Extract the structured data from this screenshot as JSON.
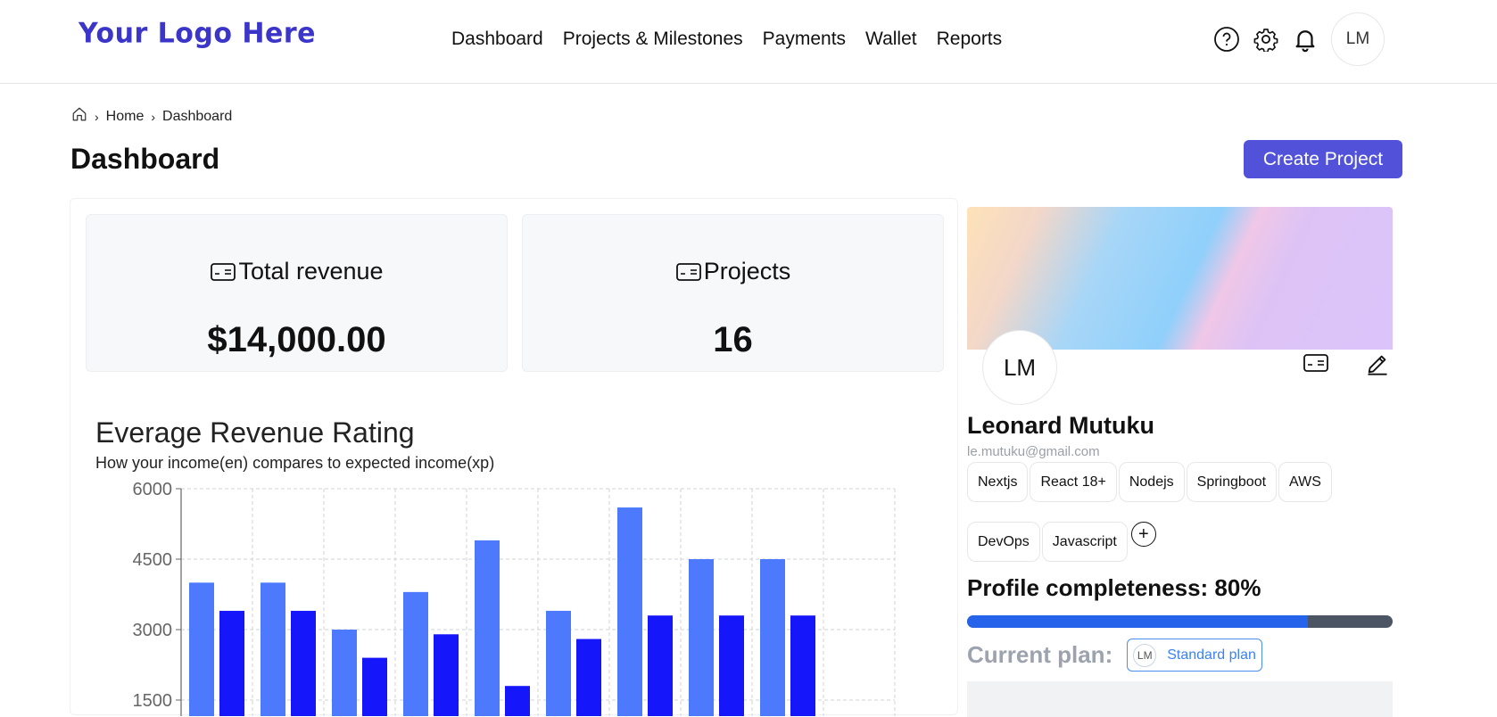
{
  "header": {
    "logo": "Your Logo Here",
    "nav": [
      "Dashboard",
      "Projects & Milestones",
      "Payments",
      "Wallet",
      "Reports"
    ],
    "avatar_initials": "LM",
    "icons": [
      "help-icon",
      "gear-icon",
      "bell-icon"
    ]
  },
  "breadcrumb": {
    "items": [
      "Home",
      "Dashboard"
    ]
  },
  "page": {
    "title": "Dashboard",
    "create_button": "Create Project"
  },
  "stats": [
    {
      "label": "Total revenue",
      "value": "$14,000.00",
      "icon": "card-icon"
    },
    {
      "label": "Projects",
      "value": "16",
      "icon": "card-icon"
    }
  ],
  "chart": {
    "title": "Everage Revenue Rating",
    "subtitle": "How your income(en) compares to expected income(xp)"
  },
  "chart_data": {
    "type": "bar",
    "title": "Everage Revenue Rating",
    "subtitle": "How your income(en) compares to expected income(xp)",
    "xlabel": "",
    "ylabel": "",
    "yticks": [
      1500,
      3000,
      4500,
      6000
    ],
    "ylim": [
      0,
      6000
    ],
    "grid": true,
    "series": [
      {
        "values": [
          4000,
          4000,
          3000,
          3800,
          4900,
          3400,
          5600,
          4500,
          4500
        ],
        "color": "#4d79fd"
      },
      {
        "values": [
          3400,
          3400,
          2400,
          2900,
          1800,
          2800,
          3300,
          3300,
          3300
        ],
        "color": "#1616fb"
      }
    ]
  },
  "profile": {
    "initials": "LM",
    "name": "Leonard Mutuku",
    "email": "le.mutuku@gmail.com",
    "skills": [
      "Nextjs",
      "React 18+",
      "Nodejs",
      "Springboot",
      "AWS",
      "DevOps",
      "Javascript"
    ],
    "add_skill": "+",
    "completeness_label": "Profile completeness: 80%",
    "completeness": 80,
    "plan_label": "Current plan:",
    "plan_initials": "LM",
    "plan_name": "Standard plan"
  }
}
